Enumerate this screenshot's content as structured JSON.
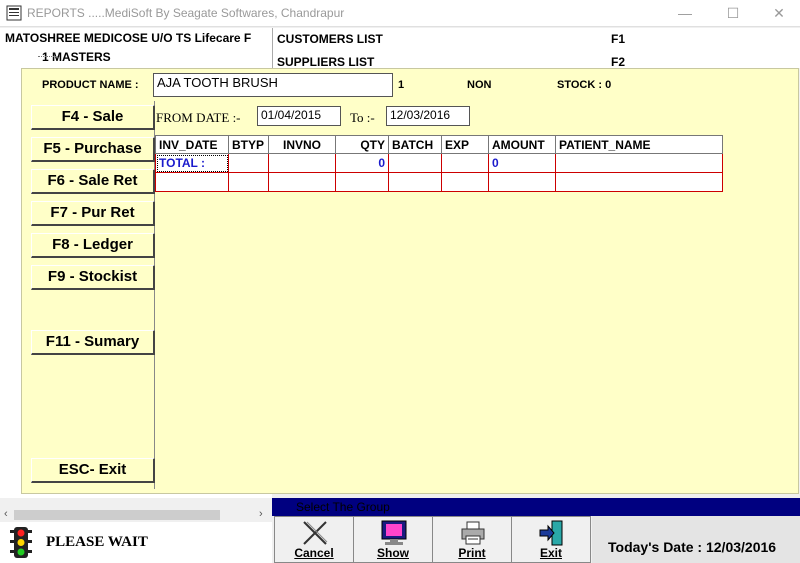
{
  "window": {
    "title": "REPORTS .....MediSoft By Seagate Softwares, Chandrapur"
  },
  "background": {
    "company": "MATOSHREE MEDICOSE U/O TS Lifecare F",
    "tree_item": "1 MASTERS",
    "list": [
      {
        "label": "CUSTOMERS LIST",
        "key": "F1"
      },
      {
        "label": "SUPPLIERS LIST",
        "key": "F2"
      }
    ]
  },
  "product": {
    "label": "PRODUCT NAME :",
    "value": "AJA TOOTH BRUSH",
    "id": "1",
    "type": "NON",
    "stock_label": "STOCK : 0"
  },
  "fkeys": [
    {
      "label": "F4 - Sale"
    },
    {
      "label": "F5 - Purchase"
    },
    {
      "label": "F6 - Sale Ret"
    },
    {
      "label": "F7 - Pur Ret"
    },
    {
      "label": "F8 - Ledger"
    },
    {
      "label": "F9 - Stockist"
    },
    {
      "label": "F11 - Sumary"
    },
    {
      "label": "ESC- Exit"
    }
  ],
  "dates": {
    "from_label": "FROM DATE  :-",
    "from_value": "01/04/2015",
    "to_label": "To :-",
    "to_value": "12/03/2016"
  },
  "grid": {
    "headers": [
      "INV_DATE",
      "BTYP",
      "INVNO",
      "QTY",
      "BATCH",
      "EXP",
      "AMOUNT",
      "PATIENT_NAME"
    ],
    "total_row": [
      "TOTAL :",
      "",
      "",
      "0",
      "",
      "",
      "0",
      ""
    ]
  },
  "status": {
    "please_wait": "PLEASE WAIT",
    "group_bar": "Select The Group"
  },
  "toolbar": [
    {
      "label": "Cancel"
    },
    {
      "label": "Show"
    },
    {
      "label": "Print"
    },
    {
      "label": "Exit"
    }
  ],
  "today": "Today's Date : 12/03/2016",
  "colors": {
    "dialog_bg": "#ffffc8",
    "grid_border": "#cc0000",
    "group_bar": "#000080",
    "total_text": "#1a1acc"
  }
}
